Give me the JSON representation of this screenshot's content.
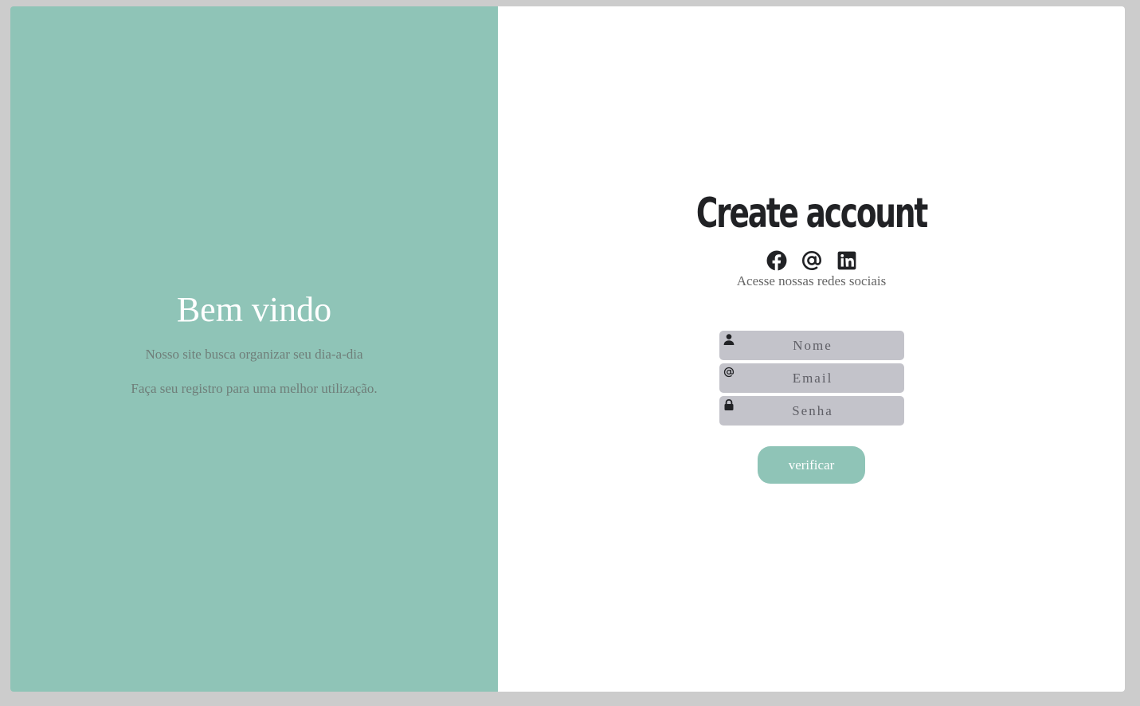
{
  "welcome": {
    "title": "Bem vindo",
    "line1": "Nosso site busca organizar seu dia-a-dia",
    "line2": "Faça seu registro para uma melhor utilização."
  },
  "form": {
    "title": "Create account",
    "social_icons": [
      "facebook-icon",
      "at-sign-icon",
      "linkedin-icon"
    ],
    "social_caption": "Acesse nossas redes sociais",
    "fields": [
      {
        "icon": "user-icon",
        "value": "",
        "placeholder": "Nome"
      },
      {
        "icon": "at-sign-icon",
        "value": "",
        "placeholder": "Email"
      },
      {
        "icon": "lock-icon",
        "value": "",
        "placeholder": "Senha"
      }
    ],
    "submit_label": "verificar"
  },
  "colors": {
    "accent": "#8fc4b7",
    "page_background": "#cccccc",
    "field_background": "#c3c3ca",
    "title_text": "#212225"
  }
}
